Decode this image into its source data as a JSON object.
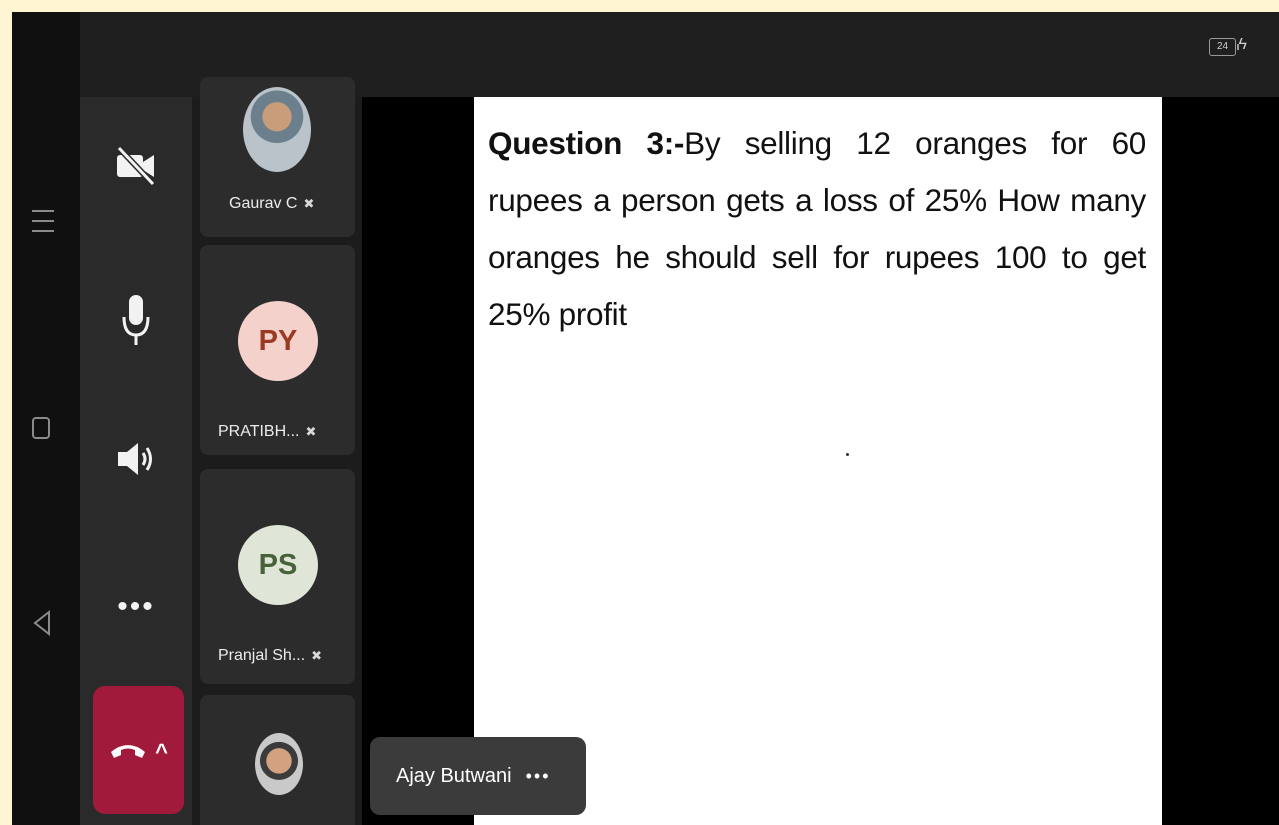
{
  "status": {
    "battery_level": "24"
  },
  "controls": {
    "camera_icon": "video-off-icon",
    "mic_icon": "microphone-icon",
    "speaker_icon": "speaker-icon",
    "more_label": "•••",
    "end_call_icon": "phone-hangup-icon",
    "expand_label": "^"
  },
  "participants": [
    {
      "name": "Gaurav C",
      "avatar": "photo",
      "muted": true
    },
    {
      "name": "PRATIBH...",
      "initials": "PY",
      "muted": true
    },
    {
      "name": "Pranjal Sh...",
      "initials": "PS",
      "muted": true
    },
    {
      "name": "",
      "avatar": "photo",
      "muted": false
    }
  ],
  "slide": {
    "label": "Question 3:-",
    "text": "By selling 12 oranges for 60 rupees a person gets a loss of 25% How many oranges he should sell for rupees 100 to get 25% profit"
  },
  "presenter": {
    "name": "Ajay Butwani",
    "more_label": "•••"
  },
  "colors": {
    "end_call": "#a11a3b",
    "py_avatar": "#f4d2cb",
    "ps_avatar": "#dfe6d8"
  }
}
